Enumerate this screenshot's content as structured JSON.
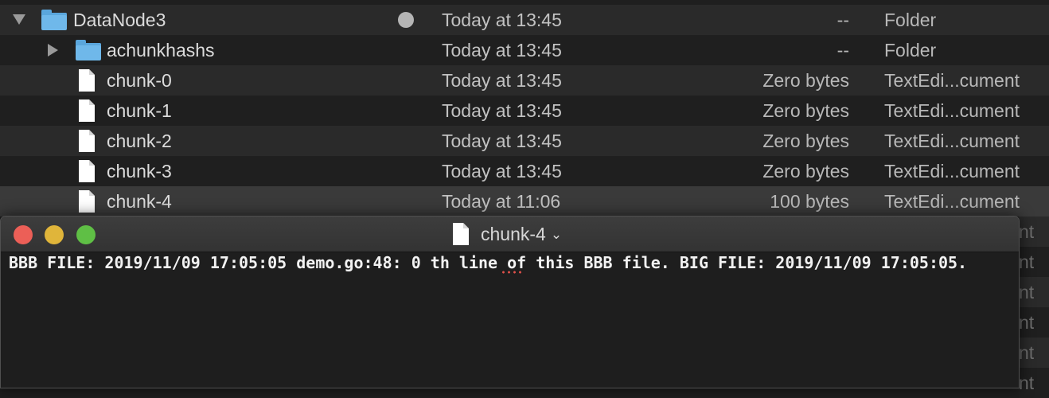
{
  "finder": {
    "rows": [
      {
        "name": "DataNode3",
        "date": "Today at 13:45",
        "size": "--",
        "kind": "Folder"
      },
      {
        "name": "achunkhashs",
        "date": "Today at 13:45",
        "size": "--",
        "kind": "Folder"
      },
      {
        "name": "chunk-0",
        "date": "Today at 13:45",
        "size": "Zero bytes",
        "kind": "TextEdi...cument"
      },
      {
        "name": "chunk-1",
        "date": "Today at 13:45",
        "size": "Zero bytes",
        "kind": "TextEdi...cument"
      },
      {
        "name": "chunk-2",
        "date": "Today at 13:45",
        "size": "Zero bytes",
        "kind": "TextEdi...cument"
      },
      {
        "name": "chunk-3",
        "date": "Today at 13:45",
        "size": "Zero bytes",
        "kind": "TextEdi...cument"
      },
      {
        "name": "chunk-4",
        "date": "Today at 11:06",
        "size": "100 bytes",
        "kind": "TextEdi...cument"
      }
    ],
    "kind_fragment": "nt"
  },
  "textedit": {
    "title": "chunk-4",
    "title_chevron": "⌄",
    "content": "BBB FILE: 2019/11/09 17:05:05 demo.go:48: 0 th line of this BBB file. BIG FILE: 2019/11/09 17:05:05."
  },
  "icons": {
    "folder": "folder-icon",
    "document": "document-icon",
    "disclosure_open": "disclosure-triangle-down-icon",
    "disclosure_closed": "disclosure-triangle-right-icon"
  },
  "colors": {
    "close": "#ec5f57",
    "minimize": "#e0b53a",
    "zoom": "#5fbf45",
    "folder_blue": "#6fb8ea"
  }
}
